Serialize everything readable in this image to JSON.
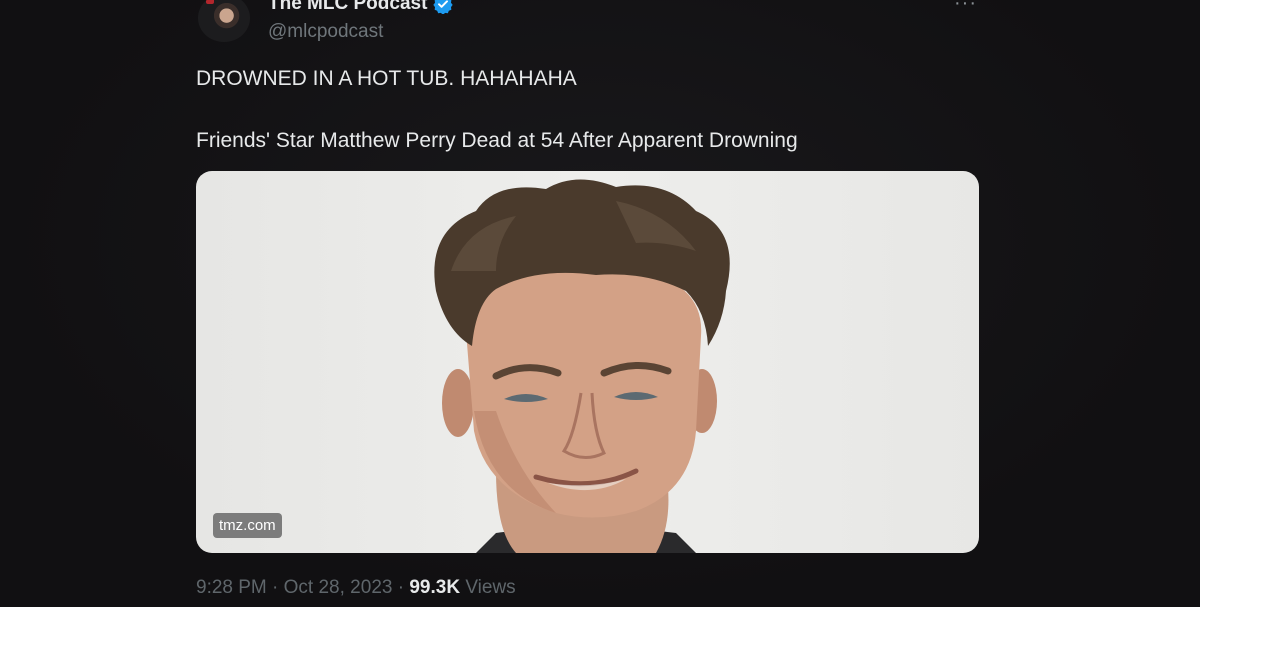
{
  "tweet": {
    "author": {
      "display_name": "The MLC Podcast",
      "handle": "@mlcpodcast",
      "verified": true,
      "verified_color": "#1d9bf0"
    },
    "more_label": "···",
    "text_line1": "DROWNED IN A HOT TUB. HAHAHAHA",
    "text_line2": "Friends' Star Matthew Perry Dead at 54 After Apparent Drowning",
    "media": {
      "source_label": "tmz.com"
    },
    "time": "9:28 PM",
    "separator": " · ",
    "date": "Oct 28, 2023",
    "views_count": "99.3K",
    "views_label": "Views"
  },
  "colors": {
    "background": "#111012",
    "text": "#e7e9ea",
    "muted": "#5f666b"
  }
}
